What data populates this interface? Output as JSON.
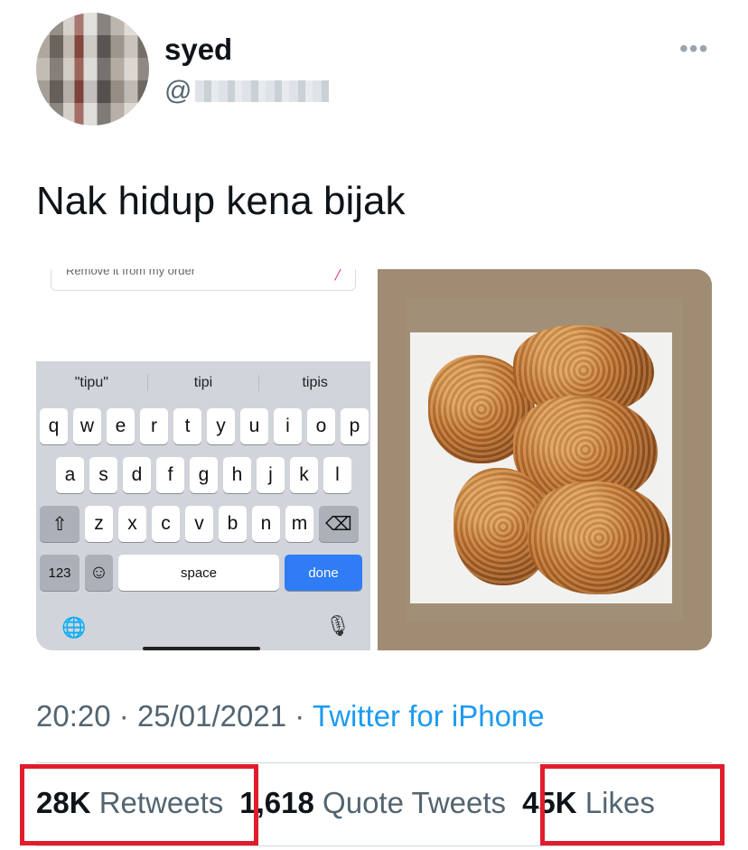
{
  "author": {
    "name": "syed",
    "handle_prefix": "@"
  },
  "tweet": {
    "text": "Nak hidup kena bijak"
  },
  "media": {
    "keyboard_screenshot": {
      "order_field_text": "Remove it from my order",
      "suggestions": [
        "\"tipu\"",
        "tipi",
        "tipis"
      ],
      "rows": [
        [
          "q",
          "w",
          "e",
          "r",
          "t",
          "y",
          "u",
          "i",
          "o",
          "p"
        ],
        [
          "a",
          "s",
          "d",
          "f",
          "g",
          "h",
          "j",
          "k",
          "l"
        ],
        [
          "z",
          "x",
          "c",
          "v",
          "b",
          "n",
          "m"
        ]
      ],
      "numbers_key": "123",
      "space_key": "space",
      "done_key": "done"
    }
  },
  "meta": {
    "time": "20:20",
    "separator": "·",
    "date": "25/01/2021",
    "source": "Twitter for iPhone"
  },
  "stats": {
    "retweets_count": "28K",
    "retweets_label": "Retweets",
    "quotes_count": "1,618",
    "quotes_label": "Quote Tweets",
    "likes_count": "45K",
    "likes_label": "Likes"
  },
  "colors": {
    "highlight": "#e11d2c",
    "link": "#1d9bf0",
    "muted": "#536471"
  }
}
